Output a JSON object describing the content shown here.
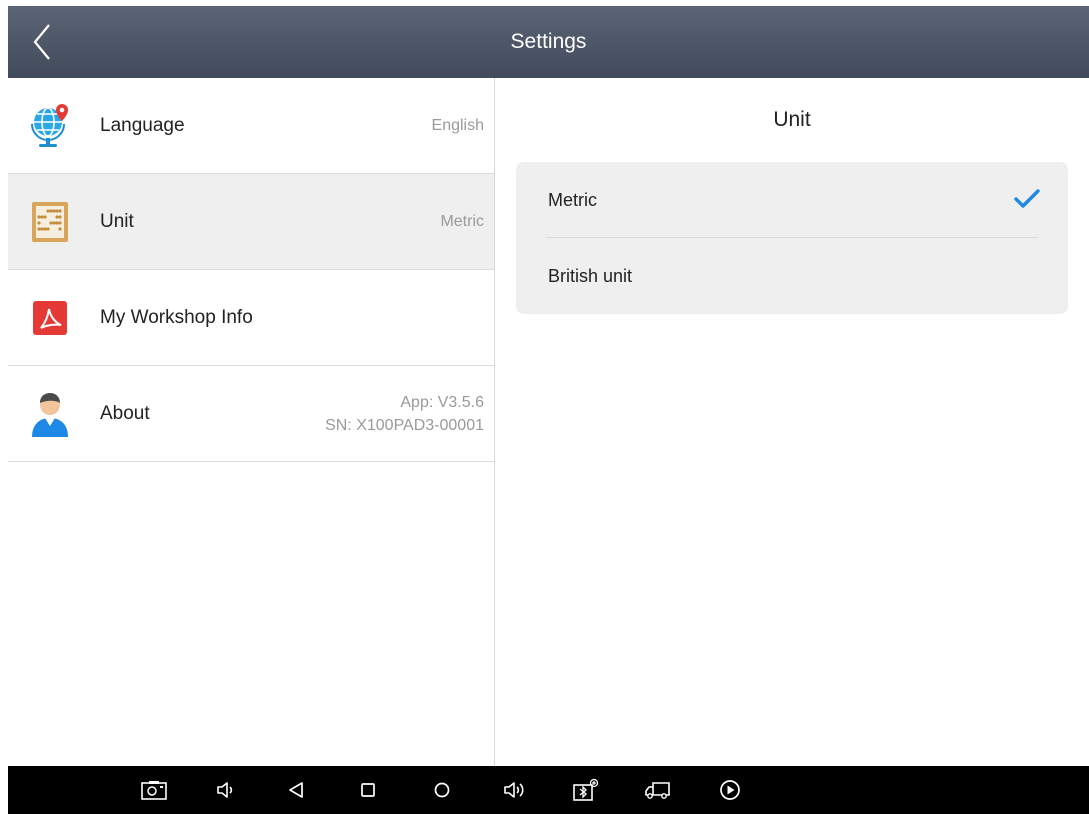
{
  "header": {
    "title": "Settings"
  },
  "left_list": {
    "items": [
      {
        "label": "Language",
        "value": "English",
        "icon": "globe-pin-icon"
      },
      {
        "label": "Unit",
        "value": "Metric",
        "icon": "abacus-icon",
        "selected": true
      },
      {
        "label": "My Workshop Info",
        "value": "",
        "icon": "pdf-icon"
      },
      {
        "label": "About",
        "value_line1": "App: V3.5.6",
        "value_line2": "SN: X100PAD3-00001",
        "icon": "user-icon"
      }
    ]
  },
  "unit_panel": {
    "title": "Unit",
    "options": [
      {
        "label": "Metric",
        "checked": true
      },
      {
        "label": "British unit",
        "checked": false
      }
    ]
  },
  "navbar": {
    "icons": [
      "screenshot-icon",
      "volume-down-icon",
      "back-triangle-icon",
      "recents-square-icon",
      "home-circle-icon",
      "volume-up-icon",
      "vci-connect-icon",
      "truck-icon",
      "play-icon"
    ]
  },
  "colors": {
    "header_bg": "#4a5465",
    "check_blue": "#1e88e5",
    "selected_row_bg": "#efefef",
    "pdf_red": "#e53935"
  }
}
